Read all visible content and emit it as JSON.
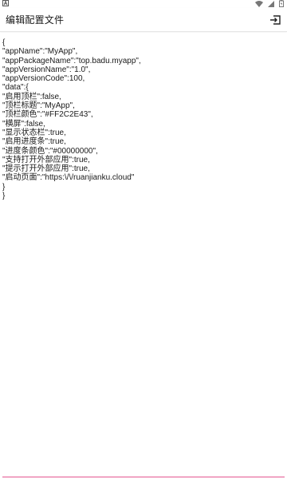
{
  "status_bar": {
    "left_icon": "notification-a-icon",
    "right_icons": [
      "wifi-icon",
      "signal-icon",
      "battery-icon"
    ]
  },
  "app_bar": {
    "title": "编辑配置文件",
    "action_icon": "save-exit-icon"
  },
  "editor": {
    "lines": [
      "{",
      "\"appName\":\"MyApp\",",
      "\"appPackageName\":\"top.badu.myapp\",",
      "\"appVersionName\":\"1.0\",",
      "\"appVersionCode\":100,",
      "\"data\":{",
      "\"启用顶栏\":false,",
      "\"顶栏标题\":\"MyApp\",",
      "\"顶栏颜色\":\"#FF2C2E43\",",
      "\"横屏\":false,",
      "\"显示状态栏\":true,",
      "\"启用进度条\":true,",
      "\"进度条颜色\":\"#00000000\",",
      "\"支持打开外部应用\":true,",
      "\"提示打开外部应用\":true,",
      "\"启动页面\":\"https:\\/\\/ruanjianku.cloud\"",
      "}",
      "}"
    ]
  },
  "colors": {
    "accent": "#e4568f",
    "text": "#1a1a1a",
    "background": "#ffffff"
  }
}
